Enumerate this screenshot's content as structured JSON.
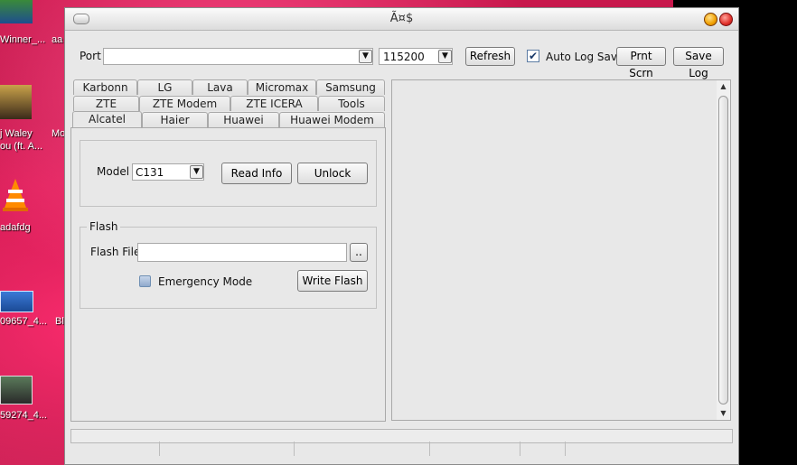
{
  "window": {
    "title": "Ã¤$"
  },
  "desktop": {
    "labels": [
      "Winner_...",
      "aa",
      "j Waley",
      "Mo",
      "ou (ft. A...",
      "adafdg",
      "09657_4...",
      "Bl",
      "59274_4..."
    ]
  },
  "port": {
    "label": "Port",
    "value": "",
    "baud": "115200",
    "refresh": "Refresh",
    "auto_log_label": "Auto Log Save",
    "auto_log_checked": true,
    "print_screen": "Prnt Scrn",
    "save_log": "Save Log"
  },
  "tabs": {
    "row1": [
      "Karbonn",
      "LG",
      "Lava",
      "Micromax",
      "Samsung"
    ],
    "row2": [
      "ZTE",
      "ZTE Modem",
      "ZTE ICERA",
      "Tools"
    ],
    "row3": [
      "Alcatel",
      "Haier",
      "Huawei",
      "Huawei Modem"
    ],
    "active": "Alcatel"
  },
  "model_group": {
    "model_label": "Model",
    "model_value": "C131",
    "read_info": "Read Info",
    "unlock": "Unlock"
  },
  "flash_group": {
    "title": "Flash",
    "flash_file_label": "Flash File",
    "flash_file_value": "",
    "browse": "..",
    "emergency_label": "Emergency Mode",
    "emergency_checked": false,
    "write_flash": "Write Flash"
  },
  "icons": {
    "dropdown": "chevron-down-icon",
    "checkbox": "check-icon",
    "scroll_up": "arrow-up-icon",
    "scroll_down": "arrow-down-icon"
  }
}
